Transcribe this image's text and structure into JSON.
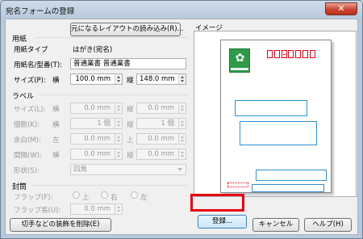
{
  "window": {
    "title": "宛名フォームの登録",
    "close_label": "✕"
  },
  "buttons": {
    "restore_layout": "元になるレイアウトの読み込み(R)...",
    "delete_decoration": "切手などの装飾を削除(E)",
    "register": "登録...",
    "cancel": "キャンセル",
    "help": "ヘルプ(H)"
  },
  "paper": {
    "section": "用紙",
    "type_label": "用紙タイプ",
    "type_value": "はがき(宛名)",
    "name_label": "用紙名/型番(T):",
    "name_value": "普通業書 普通業書",
    "size_label": "サイズ(P):",
    "width_label": "横",
    "width_value": "100.0 mm",
    "height_label": "縦",
    "height_value": "148.0 mm"
  },
  "label": {
    "section": "ラベル",
    "size_label": "サイズ(L):",
    "size_w_label": "横",
    "size_w": "0.0 mm",
    "size_h_label": "縦",
    "size_h": "0.0 mm",
    "count_label": "個数(K):",
    "count_w_label": "横",
    "count_w": "1 個",
    "count_h_label": "縦",
    "count_h": "1 個",
    "margin_label": "余白(M):",
    "margin_l_label": "左",
    "margin_l": "0.0 mm",
    "margin_t_label": "上",
    "margin_t": "0.0 mm",
    "gap_label": "間隔(W):",
    "gap_w_label": "横",
    "gap_w": "0.0 mm",
    "gap_h_label": "縦",
    "gap_h": "0.0 mm",
    "shape_label": "形状(S):",
    "shape_value": "四角"
  },
  "envelope": {
    "section": "封筒",
    "flap_label": "フラップ(F):",
    "flap_options": [
      "上",
      "右",
      "左"
    ],
    "flap_length_label": "フラップ長(U):",
    "flap_length_value": "0.0 mm"
  },
  "preview": {
    "label": "イメージ"
  }
}
